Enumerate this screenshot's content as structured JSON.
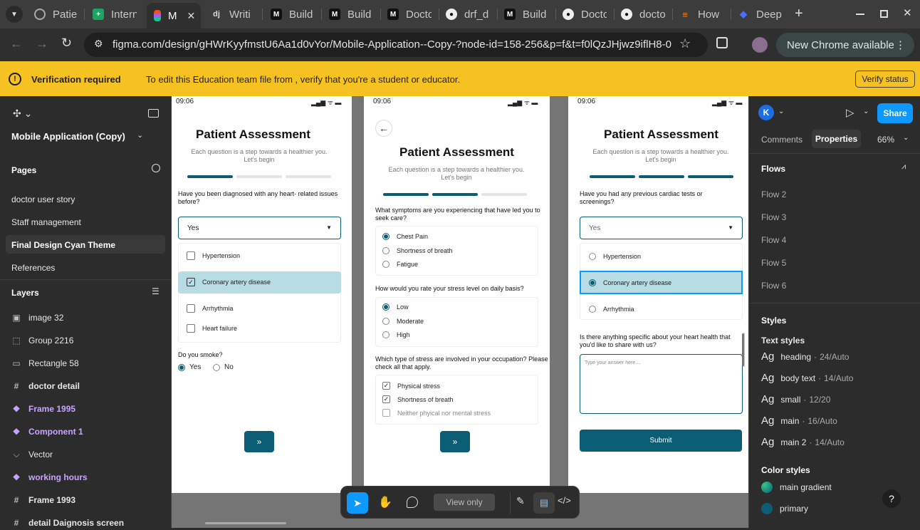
{
  "browser": {
    "tabs": [
      {
        "label": "Patie",
        "icon": "privacy-tab-icon"
      },
      {
        "label": "Intern",
        "icon": "sheets-icon"
      },
      {
        "label": "M",
        "icon": "figma-icon"
      },
      {
        "label": "Writi",
        "icon": "django-icon"
      },
      {
        "label": "Build",
        "icon": "medium-icon"
      },
      {
        "label": "Build",
        "icon": "medium-icon"
      },
      {
        "label": "Docto",
        "icon": "medium-icon"
      },
      {
        "label": "drf_d",
        "icon": "github-icon"
      },
      {
        "label": "Build",
        "icon": "medium-icon"
      },
      {
        "label": "Docto",
        "icon": "github-icon"
      },
      {
        "label": "docto",
        "icon": "github-icon"
      },
      {
        "label": "How",
        "icon": "stackoverflow-icon"
      },
      {
        "label": "Deep",
        "icon": "deepseek-icon"
      }
    ],
    "url": "figma.com/design/gHWrKyyfmstU6Aa1d0vYor/Mobile-Application--Copy-?node-id=158-256&p=f&t=f0lQzJHjwz9iflH8-0",
    "new_chrome": "New Chrome available"
  },
  "banner": {
    "title": "Verification required",
    "message": "To edit this Education team file from , verify that you're a student or educator.",
    "button": "Verify status"
  },
  "left_panel": {
    "file_name": "Mobile Application (Copy)",
    "pages_title": "Pages",
    "pages": [
      "doctor user story",
      "Staff management",
      "Final Design Cyan Theme",
      "References"
    ],
    "layers_title": "Layers",
    "layers": [
      {
        "name": "image 32",
        "icon": "image-icon",
        "kind": "plain"
      },
      {
        "name": "Group 2216",
        "icon": "group-icon",
        "kind": "plain"
      },
      {
        "name": "Rectangle 58",
        "icon": "rectangle-icon",
        "kind": "plain"
      },
      {
        "name": "doctor detail",
        "icon": "frame-icon",
        "kind": "bold"
      },
      {
        "name": "Frame 1995",
        "icon": "component-icon",
        "kind": "comp"
      },
      {
        "name": "Component 1",
        "icon": "component-icon",
        "kind": "comp"
      },
      {
        "name": "Vector",
        "icon": "vector-icon",
        "kind": "plain"
      },
      {
        "name": "working hours",
        "icon": "component-icon",
        "kind": "comp"
      },
      {
        "name": "Frame 1993",
        "icon": "frame-icon",
        "kind": "bold"
      },
      {
        "name": "detail Daignosis screen",
        "icon": "frame-icon",
        "kind": "bold"
      }
    ]
  },
  "screens": {
    "time": "09:06",
    "title": "Patient Assessment",
    "subtitle": "Each question is a step towards a healthier you. Let's begin",
    "s1": {
      "q1": "Have you been diagnosed with any heart- related issues before?",
      "select": "Yes",
      "options": [
        "Hypertension",
        "Coronary artery disease",
        "Arrhythmia",
        "Heart failure"
      ],
      "q2": "Do you smoke?",
      "yes": "Yes",
      "no": "No",
      "next": "»"
    },
    "s2": {
      "q1": "What symptoms are you experiencing that have led you to seek care?",
      "q1_options": [
        "Chest Pain",
        "Shortness of breath",
        "Fatigue"
      ],
      "q2": "How would you rate your stress level on daily basis?",
      "q2_options": [
        "Low",
        "Moderate",
        "High"
      ],
      "q3": "Which type of stress are involved in your occupation? Please check all that apply.",
      "q3_options": [
        "Physical stress",
        "Shortness of breath",
        "Neither phyical nor mental stress"
      ],
      "next": "»"
    },
    "s3": {
      "q1": "Have you had any previous cardiac tests or screenings?",
      "select": "Yes",
      "options": [
        "Hypertension",
        "Coronary artery disease",
        "Arrhythmia"
      ],
      "q2": "Is there anything specific about your heart health that you'd like to share with us?",
      "placeholder": "Type your answer here....",
      "submit": "Submit"
    }
  },
  "toolbar": {
    "view_only": "View only"
  },
  "right_panel": {
    "avatar": "K",
    "share": "Share",
    "tab_comments": "Comments",
    "tab_properties": "Properties",
    "zoom": "66%",
    "flows_title": "Flows",
    "flows": [
      "Flow 2",
      "Flow 3",
      "Flow 4",
      "Flow 5",
      "Flow 6"
    ],
    "styles_title": "Styles",
    "text_styles_title": "Text styles",
    "text_styles": [
      {
        "name": "heading",
        "spec": "24/Auto"
      },
      {
        "name": "body text",
        "spec": "14/Auto"
      },
      {
        "name": "small",
        "spec": "12/20"
      },
      {
        "name": "main",
        "spec": "16/Auto"
      },
      {
        "name": "main 2",
        "spec": "14/Auto"
      }
    ],
    "color_styles_title": "Color styles",
    "color_styles": [
      {
        "name": "main gradient",
        "color": "#1aa37a"
      },
      {
        "name": "primary",
        "color": "#0b5d73"
      }
    ]
  },
  "colors": {
    "primary": "#0b5d73",
    "selected_bg": "#b8dce3",
    "banner": "#f5c221",
    "figma_blue": "#0d99ff"
  }
}
